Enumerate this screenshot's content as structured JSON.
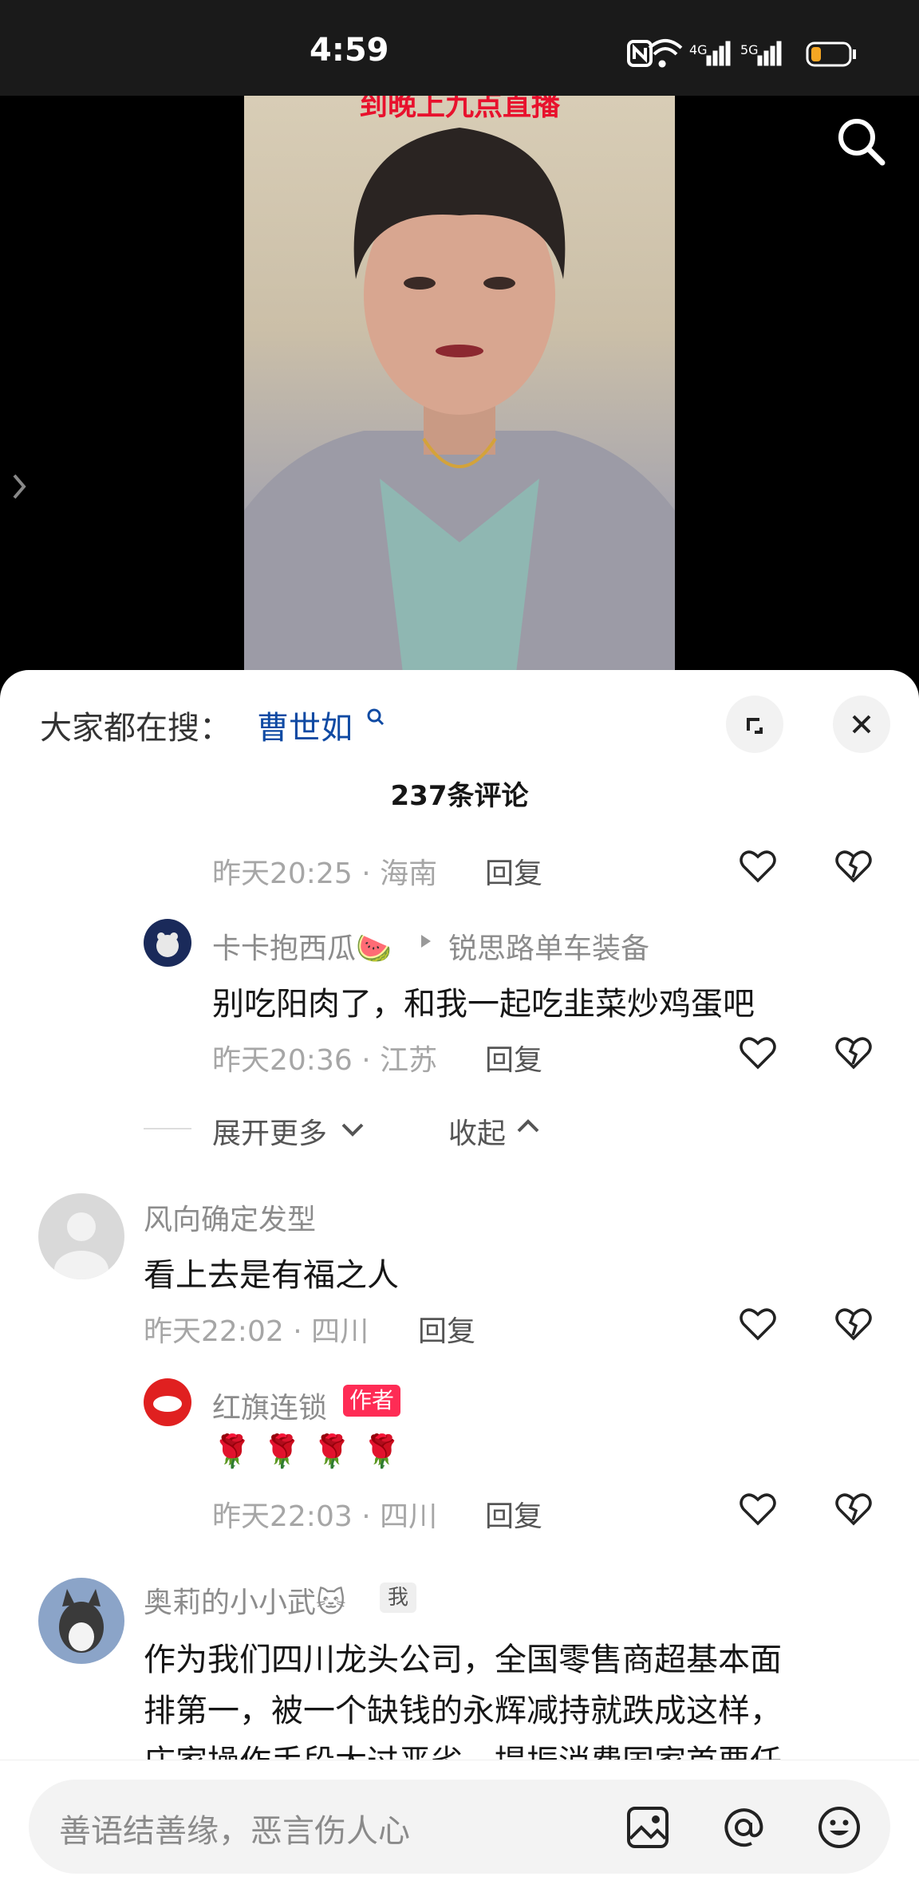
{
  "status_bar": {
    "time": "4:59",
    "signal_labels": [
      "4G",
      "5G"
    ]
  },
  "video": {
    "overlay_text": "到晚上九点直播"
  },
  "sheet": {
    "search_label": "大家都在搜：",
    "search_term": "曹世如",
    "comment_count": "237条评论"
  },
  "comments": [
    {
      "meta": "昨天20:25 · 海南",
      "reply": "回复"
    },
    {
      "name": "卡卡抱西瓜🍉",
      "reply_to": "锐思路单车装备",
      "text": "别吃阳肉了，和我一起吃韭菜炒鸡蛋吧",
      "meta": "昨天20:36 · 江苏",
      "reply": "回复"
    },
    {
      "name": "风向确定发型",
      "text": "看上去是有福之人",
      "meta": "昨天22:02 · 四川",
      "reply": "回复"
    },
    {
      "name": "红旗连锁",
      "badge": "作者",
      "text": "🌹 🌹 🌹 🌹",
      "meta": "昨天22:03 · 四川",
      "reply": "回复"
    },
    {
      "name": "奥莉的小小武🐱",
      "badge": "我",
      "text_lines": [
        "作为我们四川龙头公司，全国零售商超基本面",
        "排第一，被一个缺钱的永辉减持就跌成这样，",
        "庄家操作手段太过恶劣，提振消费国家首要任"
      ]
    }
  ],
  "thread_controls": {
    "expand": "展开更多",
    "collapse": "收起"
  },
  "input": {
    "placeholder": "善语结善缘，恶言伤人心"
  },
  "colors": {
    "accent": "#fe2c55",
    "search_term": "#0f4aa3"
  }
}
